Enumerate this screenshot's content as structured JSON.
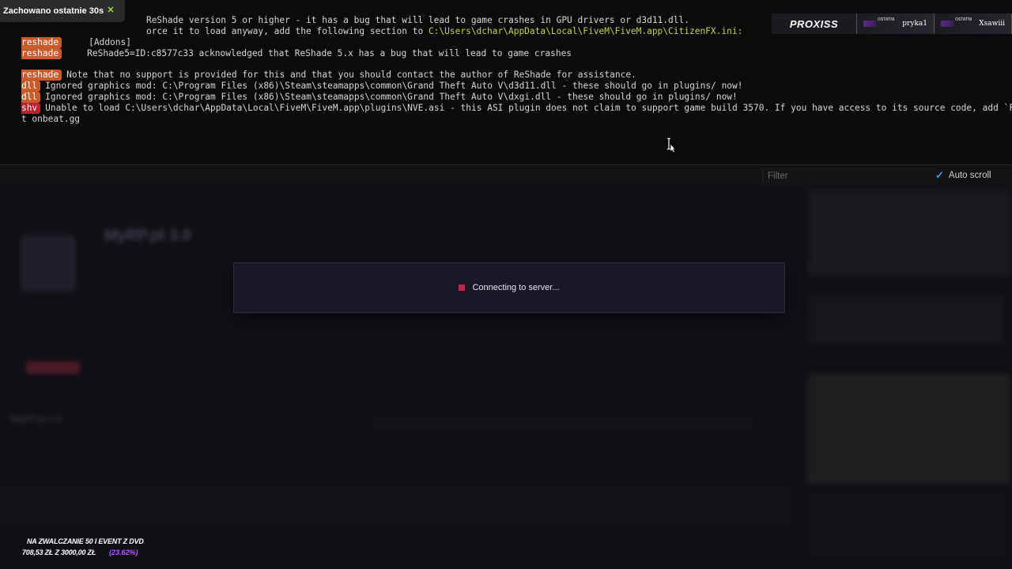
{
  "toast": {
    "text": "Zachowano ostatnie 30s",
    "icon": "close-icon"
  },
  "console": {
    "lines": [
      {
        "tag": "",
        "text": "ReShade version 5 or higher - it has a bug that will lead to game crashes in GPU drivers or d3d11.dll."
      },
      {
        "tag": "",
        "text_before": "orce it to load anyway, add the following section to ",
        "path": "C:\\Users\\dchar\\AppData\\Local\\FiveM\\FiveM.app\\CitizenFX.ini:"
      },
      {
        "tag": "reshade",
        "text": "[Addons]"
      },
      {
        "tag": "reshade",
        "text": "ReShade5=ID:c8577c33 acknowledged that ReShade 5.x has a bug that will lead to game crashes"
      },
      {
        "tag": "reshade",
        "text": "Note that no support is provided for this and that you should contact the author of ReShade for assistance."
      },
      {
        "tag": "dll",
        "text": "Ignored graphics mod: C:\\Program Files (x86)\\Steam\\steamapps\\common\\Grand Theft Auto V\\d3d11.dll - these should go in plugins/ now!"
      },
      {
        "tag": "dll",
        "text": "Ignored graphics mod: C:\\Program Files (x86)\\Steam\\steamapps\\common\\Grand Theft Auto V\\dxgi.dll - these should go in plugins/ now!"
      },
      {
        "tag": "shv",
        "text": "Unable to load C:\\Users\\dchar\\AppData\\Local\\FiveM\\FiveM.app\\plugins\\NVE.asi - this ASI plugin does not claim to support game build 3570. If you have access to its source code, add `FX_ASI_BUIL"
      },
      {
        "tag": "",
        "text": "t onbeat.gg"
      }
    ]
  },
  "overlay": {
    "brand": "PROXISS",
    "users": [
      {
        "label": "OSTATNI",
        "name": "pryka1"
      },
      {
        "label": "OSTATNI",
        "name": "Xsawiii"
      }
    ]
  },
  "filterbar": {
    "filter_placeholder": "Filter",
    "autoscroll_label": "Auto scroll",
    "autoscroll_checked": true
  },
  "background_app": {
    "title": "MyRP.pl 3.0",
    "server_name": "MyRP.pl 3.0"
  },
  "modal": {
    "message": "Connecting to server..."
  },
  "donation": {
    "title": "NA ZWALCZANIE 50 I EVENT Z DVD",
    "amount": "708,53 ZŁ  Z  3000,00 ZŁ",
    "percent": "(23.62%)",
    "progress": 0.2362
  },
  "colors": {
    "reshade_tag": "#c95a2b",
    "error_tag": "#b8212d",
    "path_highlight": "#c6d34a",
    "accent_check": "#3e9be8",
    "spinner": "#c2244e"
  }
}
